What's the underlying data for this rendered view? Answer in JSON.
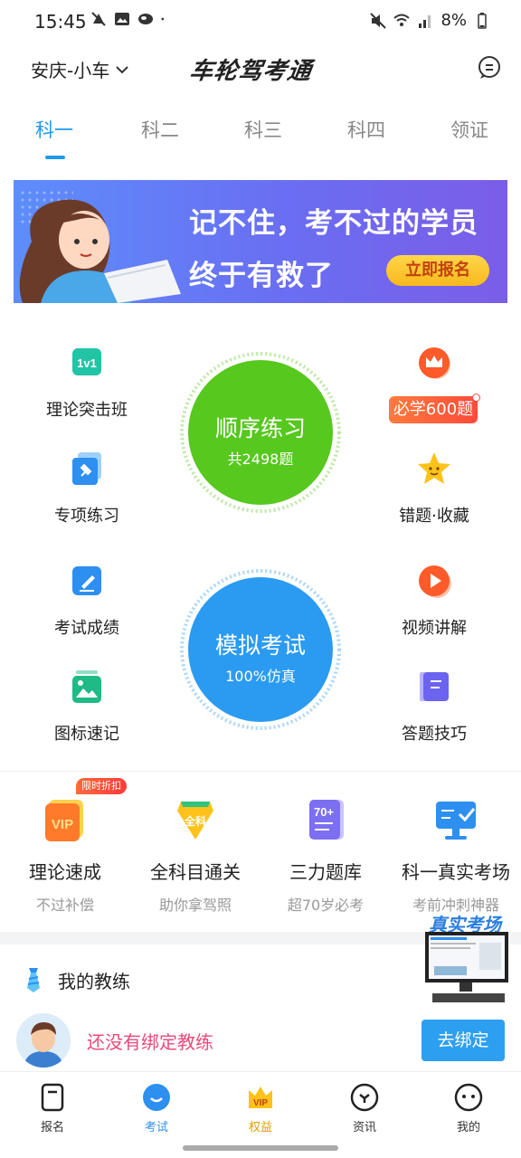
{
  "status": {
    "time": "15:45",
    "battery": "8%"
  },
  "header": {
    "city": "安庆-小车",
    "logo": "车轮驾考通"
  },
  "tabs": [
    "科一",
    "科二",
    "科三",
    "科四",
    "领证"
  ],
  "banner": {
    "line1": "记不住，考不过的学员",
    "line2": "终于有救了",
    "cta": "立即报名"
  },
  "features": {
    "left": [
      "理论突击班",
      "专项练习",
      "考试成绩",
      "图标速记"
    ],
    "right": [
      "必学600题",
      "错题·收藏",
      "视频讲解",
      "答题技巧"
    ],
    "left_icons": [
      "1v1-icon",
      "pin-icon",
      "edit-icon",
      "image-icon"
    ],
    "right_icons": [
      "crown-icon",
      "star-icon",
      "play-icon",
      "book-icon"
    ]
  },
  "practice": {
    "title": "顺序练习",
    "subtitle": "共2498题"
  },
  "exam": {
    "title": "模拟考试",
    "subtitle": "100%仿真"
  },
  "vip": {
    "limited_badge": "限时折扣",
    "items": [
      {
        "title": "理论速成",
        "sub": "不过补偿",
        "icon": "vip-icon"
      },
      {
        "title": "全科目通关",
        "sub": "助你拿驾照",
        "icon": "all-subjects-icon"
      },
      {
        "title": "三力题库",
        "sub": "超70岁必考",
        "icon": "70-plus-icon"
      },
      {
        "title": "科一真实考场",
        "sub": "考前冲刺神器",
        "icon": "monitor-check-icon"
      }
    ]
  },
  "promo": {
    "label": "真实考场"
  },
  "coach": {
    "section_title": "我的教练",
    "message": "还没有绑定教练",
    "button": "去绑定"
  },
  "bottom_nav": [
    {
      "label": "报名",
      "icon": "signup-icon"
    },
    {
      "label": "考试",
      "icon": "exam-icon"
    },
    {
      "label": "权益",
      "icon": "vip-crown-icon"
    },
    {
      "label": "资讯",
      "icon": "news-icon"
    },
    {
      "label": "我的",
      "icon": "profile-icon"
    }
  ],
  "colors": {
    "accent": "#1e9bea",
    "green": "#4fc21e",
    "blue": "#2d9ff0",
    "pink": "#e94a7a",
    "orange": "#ff5a2a"
  }
}
